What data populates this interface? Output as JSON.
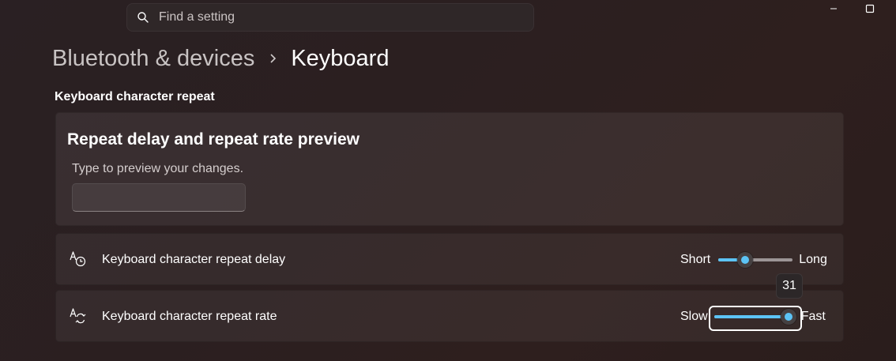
{
  "search": {
    "placeholder": "Find a setting"
  },
  "breadcrumb": {
    "parent": "Bluetooth & devices",
    "current": "Keyboard"
  },
  "section": {
    "title": "Keyboard character repeat"
  },
  "preview": {
    "title": "Repeat delay and repeat rate preview",
    "subtitle": "Type to preview your changes.",
    "input_value": ""
  },
  "delay": {
    "label": "Keyboard character repeat delay",
    "min_label": "Short",
    "max_label": "Long",
    "value_fraction": 0.36
  },
  "rate": {
    "label": "Keyboard character repeat rate",
    "min_label": "Slow",
    "max_label": "Fast",
    "value": 31,
    "value_fraction": 1.0,
    "tooltip": "31"
  },
  "colors": {
    "accent": "#5cc3f5",
    "background": "#2b1f20"
  },
  "icons": {
    "search": "search-icon",
    "minimize": "minimize-icon",
    "maximize": "maximize-icon",
    "chevron": "chevron-right-icon",
    "delay": "keyboard-delay-icon",
    "rate": "keyboard-rate-icon"
  }
}
